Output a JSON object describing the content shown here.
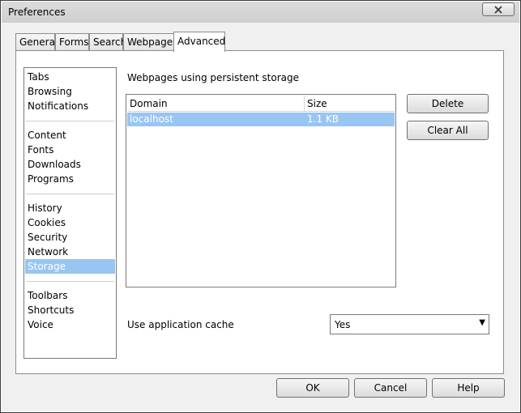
{
  "window": {
    "title": "Preferences"
  },
  "tabs": [
    {
      "label": "General",
      "active": false
    },
    {
      "label": "Forms",
      "active": false
    },
    {
      "label": "Search",
      "active": false
    },
    {
      "label": "Webpages",
      "active": false
    },
    {
      "label": "Advanced",
      "active": true
    }
  ],
  "sidebar": {
    "groups": [
      [
        "Tabs",
        "Browsing",
        "Notifications"
      ],
      [
        "Content",
        "Fonts",
        "Downloads",
        "Programs"
      ],
      [
        "History",
        "Cookies",
        "Security",
        "Network",
        "Storage"
      ],
      [
        "Toolbars",
        "Shortcuts",
        "Voice"
      ]
    ],
    "selected": "Storage"
  },
  "storage": {
    "heading": "Webpages using persistent storage",
    "columns": [
      "Domain",
      "Size"
    ],
    "rows": [
      {
        "domain": "localhost",
        "size": "1.1 KB",
        "selected": true
      }
    ],
    "delete_label": "Delete",
    "clear_all_label": "Clear All"
  },
  "cache": {
    "label": "Use application cache",
    "value": "Yes"
  },
  "footer": {
    "ok_label": "OK",
    "cancel_label": "Cancel",
    "help_label": "Help"
  },
  "colors": {
    "selection": "#99c5f2",
    "window_bg": "#f0f0f0"
  },
  "icons": {
    "close": "close-icon",
    "dropdown": "chevron-down-icon"
  }
}
